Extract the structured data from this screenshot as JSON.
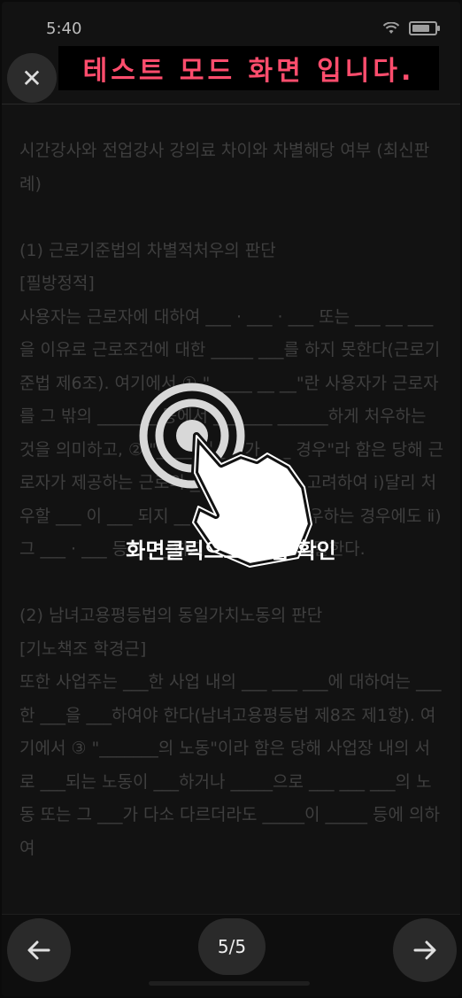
{
  "status_bar": {
    "time": "5:40",
    "battery_level": 0.8
  },
  "header": {
    "banner_text": "테스트 모드 화면 입니다."
  },
  "content": {
    "paragraphs": [
      "시간강사와 전업강사 강의료 차이와 차별해당 여부 (최신판례)",
      "",
      "(1) 근로기준법의 차별적처우의 판단",
      "[필방정적]",
      "사용자는 근로자에 대하여 ___ · ___ · ___ 또는 ___ __ ___을 이유로 근로조건에 대한 _____ ___를 하지 못한다(근로기준법 제6조). 여기에서 ① \"_____ __ __\"란 사용자가 근로자를 그 밖의 _______ 등에서 _______ ______하게 처우하는 것을 의미하고, ② \"_____인 ___가 ___ 경우\"라 함은 당해 근로자가 제공하는 근로의 ___을 ____으로 고려하여 ⅰ)달리 처우할 ___ 이 ___ 되지 ___ 하거나 달리 처우하는 경우에도 ⅱ) 그 ___ · ___ 등이 ___하지 아니한 경우를 말한다.",
      "",
      "(2) 남녀고용평등법의 동일가치노동의 판단",
      "[기노책조 학경근]",
      "또한 사업주는 ___한 사업 내의 ___ ___ ___에 대하여는 ___한 ___을 ___하여야 한다(남녀고용평등법 제8조 제1항). 여기에서 ③ \"_______의 노동\"이라 함은 당해 사업장 내의 서로 ___되는 노동이 ___하거나 _____으로 ___ ___ ___의 노동 또는 그 ___가 다소 다르더라도 _____이 _____ 등에 의하여"
    ]
  },
  "overlay": {
    "hint": "화면클릭으로 정답 확인",
    "icon": "tap-hand-icon"
  },
  "footer": {
    "page_indicator": "5/5",
    "prev_icon": "arrow-left-icon",
    "next_icon": "arrow-right-icon"
  }
}
